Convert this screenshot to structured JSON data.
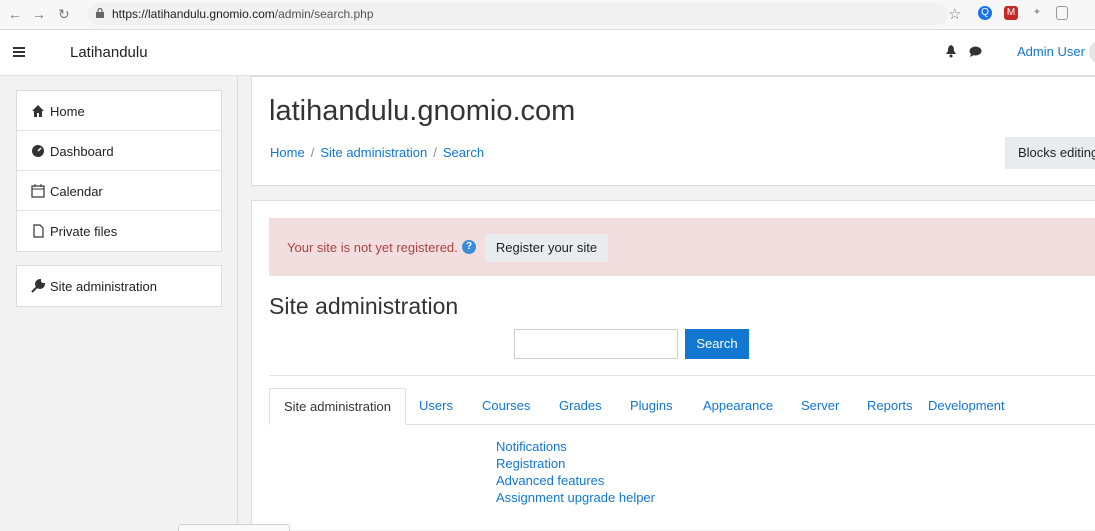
{
  "browser": {
    "url_prefix": "https://latihandulu.gnomio.com",
    "url_path": "/admin/search.php",
    "back_icon": "arrow-left",
    "forward_icon": "arrow-right",
    "reload_icon": "reload"
  },
  "navbar": {
    "site_name": "Latihandulu",
    "user_name": "Admin User"
  },
  "sidebar": {
    "items": [
      {
        "label": "Home",
        "icon": "home-icon"
      },
      {
        "label": "Dashboard",
        "icon": "dashboard-icon"
      },
      {
        "label": "Calendar",
        "icon": "calendar-icon"
      },
      {
        "label": "Private files",
        "icon": "file-icon"
      }
    ],
    "admin": {
      "label": "Site administration",
      "icon": "wrench-icon"
    }
  },
  "header": {
    "title": "latihandulu.gnomio.com",
    "breadcrumbs": [
      "Home",
      "Site administration",
      "Search"
    ],
    "blocks_editing": "Blocks editing on"
  },
  "alert": {
    "text": "Your site is not yet registered.",
    "button": "Register your site"
  },
  "admin": {
    "heading": "Site administration",
    "search_button": "Search",
    "search_value": "",
    "tabs": [
      "Site administration",
      "Users",
      "Courses",
      "Grades",
      "Plugins",
      "Appearance",
      "Server",
      "Reports",
      "Development"
    ],
    "links": [
      "Notifications",
      "Registration",
      "Advanced features",
      "Assignment upgrade helper"
    ]
  },
  "colors": {
    "link": "#1177d1",
    "alert_bg": "#f2dede",
    "alert_text": "#a94442",
    "primary_button": "#1177d1"
  }
}
